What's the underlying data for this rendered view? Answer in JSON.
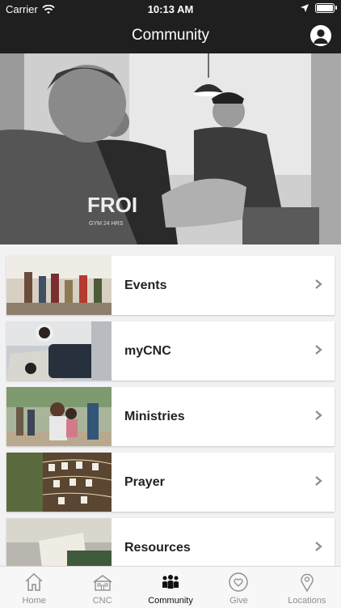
{
  "status_bar": {
    "carrier": "Carrier",
    "time": "10:13 AM"
  },
  "header": {
    "title": "Community"
  },
  "menu": {
    "items": [
      {
        "label": "Events"
      },
      {
        "label": "myCNC"
      },
      {
        "label": "Ministries"
      },
      {
        "label": "Prayer"
      },
      {
        "label": "Resources"
      }
    ]
  },
  "hero_text": {
    "shirt": "FROI",
    "shirt_sub": "GYM 24 HRS"
  },
  "tabbar": {
    "tabs": [
      {
        "label": "Home",
        "icon": "home-icon"
      },
      {
        "label": "CNC",
        "icon": "building-icon"
      },
      {
        "label": "Community",
        "icon": "people-group-icon",
        "active": true
      },
      {
        "label": "Give",
        "icon": "heart-circle-icon"
      },
      {
        "label": "Locations",
        "icon": "location-pin-icon"
      }
    ]
  }
}
